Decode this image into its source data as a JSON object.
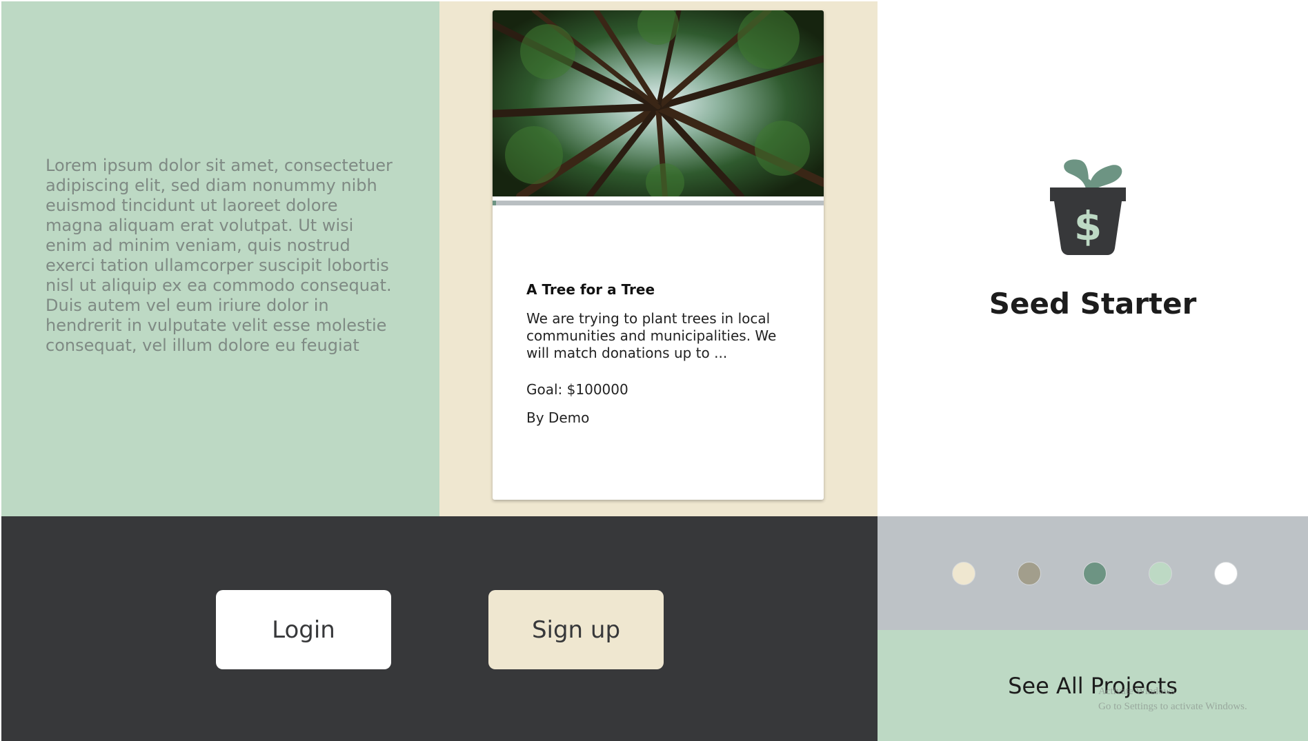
{
  "lorem": {
    "text": "Lorem ipsum dolor sit amet, consectetuer adipiscing elit, sed diam nonummy nibh euismod tincidunt ut laoreet dolore magna aliquam erat volutpat. Ut wisi enim ad minim veniam, quis nostrud exerci tation ullamcorper suscipit lobortis nisl ut aliquip ex ea commodo consequat. Duis autem vel eum iriure dolor in hendrerit in vulputate velit esse molestie consequat, vel illum dolore eu feugiat"
  },
  "card": {
    "title": "A Tree for a Tree",
    "description": "We are trying to plant trees in local communities and municipalities. We will match donations up to ...",
    "goal": "Goal: $100000",
    "author": "By Demo",
    "progress_fraction": 0.01
  },
  "brand": {
    "name": "Seed Starter",
    "logo_icon": "plant-pot-dollar-icon"
  },
  "auth": {
    "login_label": "Login",
    "signup_label": "Sign up"
  },
  "swatches": [
    "#efe7d0",
    "#a29e8c",
    "#6d9483",
    "#bdd9c4",
    "#ffffff"
  ],
  "projects": {
    "see_all_label": "See All Projects"
  },
  "watermark": {
    "line1": "Activate Windows",
    "line2": "Go to Settings to activate Windows."
  },
  "colors": {
    "mint": "#bdd9c4",
    "cream": "#efe7d0",
    "charcoal": "#37383a",
    "sage": "#6d9483",
    "gray": "#bdc2c6"
  }
}
